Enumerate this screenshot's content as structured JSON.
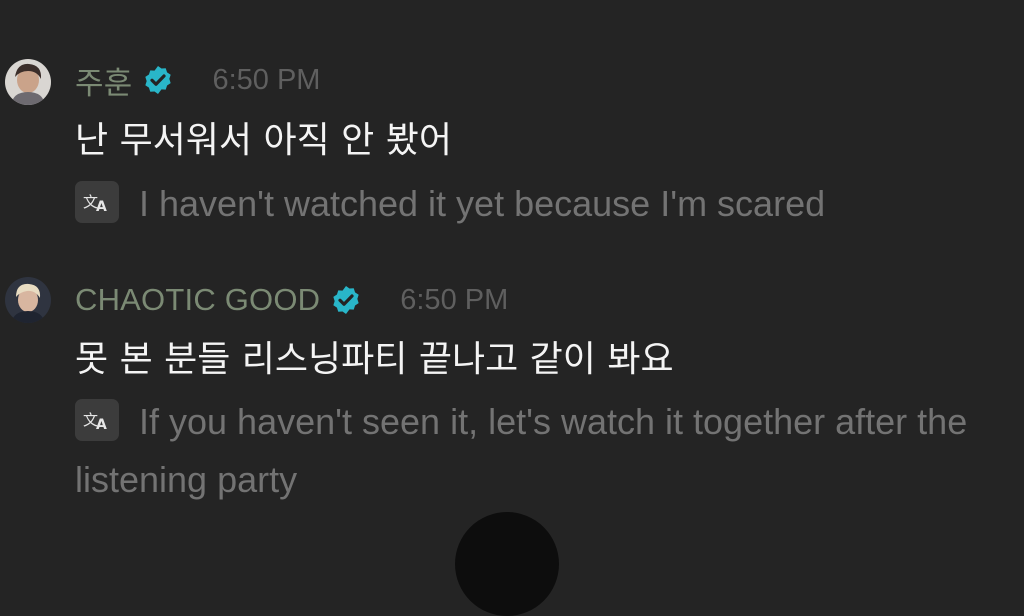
{
  "messages": [
    {
      "username": "주훈",
      "time": "6:50 PM",
      "text": "난 무서워서 아직 안 봤어",
      "translation": "I haven't watched it yet because I'm scared"
    },
    {
      "username": "CHAOTIC GOOD",
      "time": "6:50 PM",
      "text": "못 본 분들 리스닝파티 끝나고 같이 봐요",
      "translation": "If you haven't seen it, let's watch it together after the listening party"
    }
  ],
  "icons": {
    "verified": "verified-badge-icon",
    "translate": "translate-icon"
  },
  "colors": {
    "background": "#242424",
    "username": "#7b8a74",
    "verified": "#29b6c9",
    "message_text": "#f4f4f4",
    "translation_text": "#737373"
  }
}
